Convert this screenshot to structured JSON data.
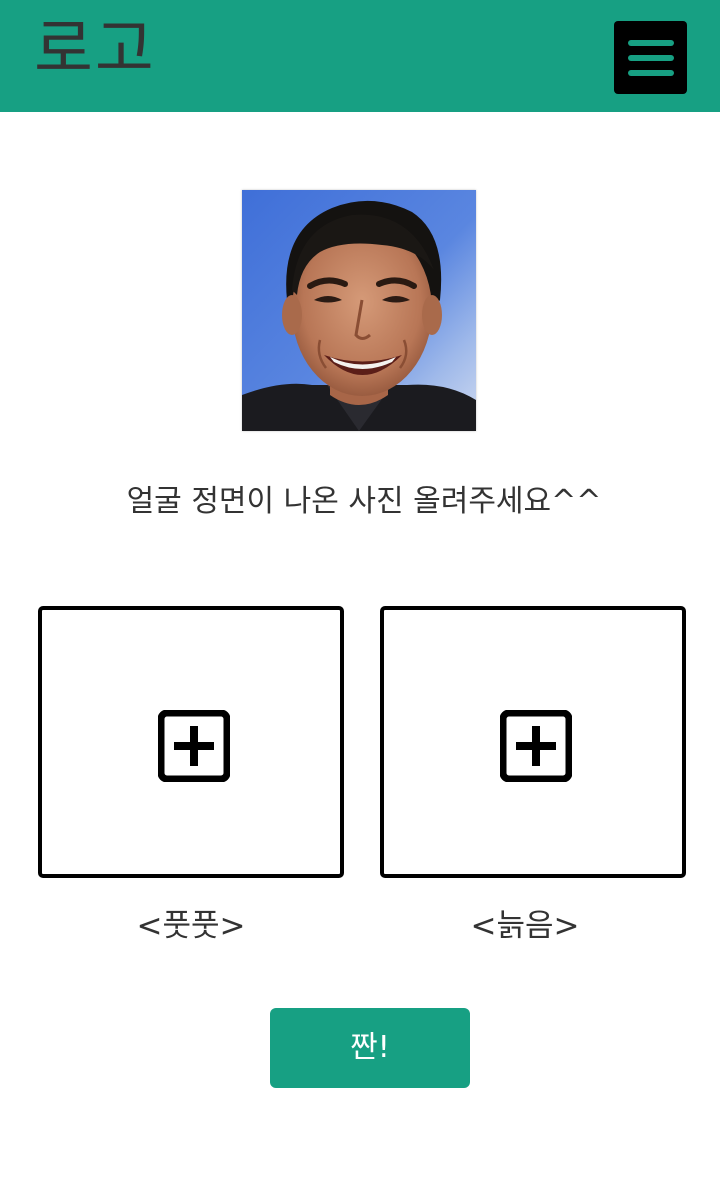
{
  "header": {
    "logo": "로고",
    "menu_icon": "hamburger-menu-icon",
    "background_color": "#17a083"
  },
  "profile_photo": {
    "alt": "smiling man face photo"
  },
  "instruction": "얼굴 정면이 나온 사진 올려주세요^^",
  "upload_slots": [
    {
      "icon": "plus-square-icon",
      "label": "<풋풋>"
    },
    {
      "icon": "plus-square-icon",
      "label": "<늙음>"
    }
  ],
  "submit": {
    "label": "짠!",
    "color": "#17a083"
  }
}
